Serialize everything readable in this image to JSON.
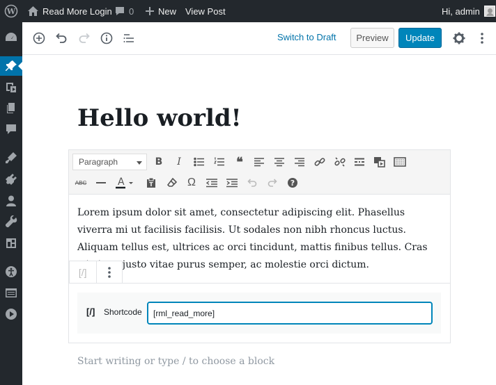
{
  "adminbar": {
    "site_name": "Read More Login",
    "comments_count": "0",
    "new_label": "New",
    "view_post_label": "View Post",
    "greeting": "Hi, admin",
    "icons": [
      "wordpress-icon",
      "home-icon",
      "comment-icon",
      "plus-icon",
      "avatar"
    ]
  },
  "sidemenu": {
    "icons": [
      "dashboard-icon",
      "pin-icon",
      "media-icon",
      "pages-icon",
      "comments-icon",
      "appearance-icon",
      "plugins-icon",
      "users-icon",
      "tools-icon",
      "settings-icon",
      "accessibility-icon",
      "layout-icon",
      "play-icon"
    ],
    "current": "pin-icon",
    "accent": "#0073aa"
  },
  "header": {
    "switch_to_draft": "Switch to Draft",
    "preview": "Preview",
    "update": "Update",
    "icons": [
      "add-block-icon",
      "undo-icon",
      "redo-icon",
      "info-icon",
      "outline-icon",
      "gear-icon",
      "more-icon"
    ]
  },
  "post": {
    "title": "Hello world!"
  },
  "classic_toolbar": {
    "format": "Paragraph",
    "row1_icons": [
      "bold-icon",
      "italic-icon",
      "bullet-list-icon",
      "numbered-list-icon",
      "blockquote-icon",
      "align-left-icon",
      "align-center-icon",
      "align-right-icon",
      "link-icon",
      "unlink-icon",
      "read-more-icon",
      "media-icon",
      "toolbar-toggle-icon"
    ],
    "row2_icons": [
      "strikethrough-icon",
      "horizontal-line-icon",
      "text-color-icon",
      "paste-text-icon",
      "clear-formatting-icon",
      "special-character-icon",
      "outdent-icon",
      "indent-icon",
      "undo-icon",
      "redo-icon",
      "help-icon"
    ]
  },
  "paragraph": {
    "text": "Lorem ipsum dolor sit amet, consectetur adipiscing elit. Phasellus viverra mi ut facilisis facilisis. Ut sodales non nibh rhoncus luctus. Aliquam tellus est, ultrices ac orci tincidunt, mattis finibus tellus. Cras tristique justo vitae purus semper, ac molestie orci dictum."
  },
  "block_mover": {
    "icon": "[/]"
  },
  "shortcode": {
    "icon": "[/]",
    "label": "Shortcode",
    "value": "[rml_read_more]"
  },
  "appender": {
    "placeholder": "Start writing or type / to choose a block"
  }
}
